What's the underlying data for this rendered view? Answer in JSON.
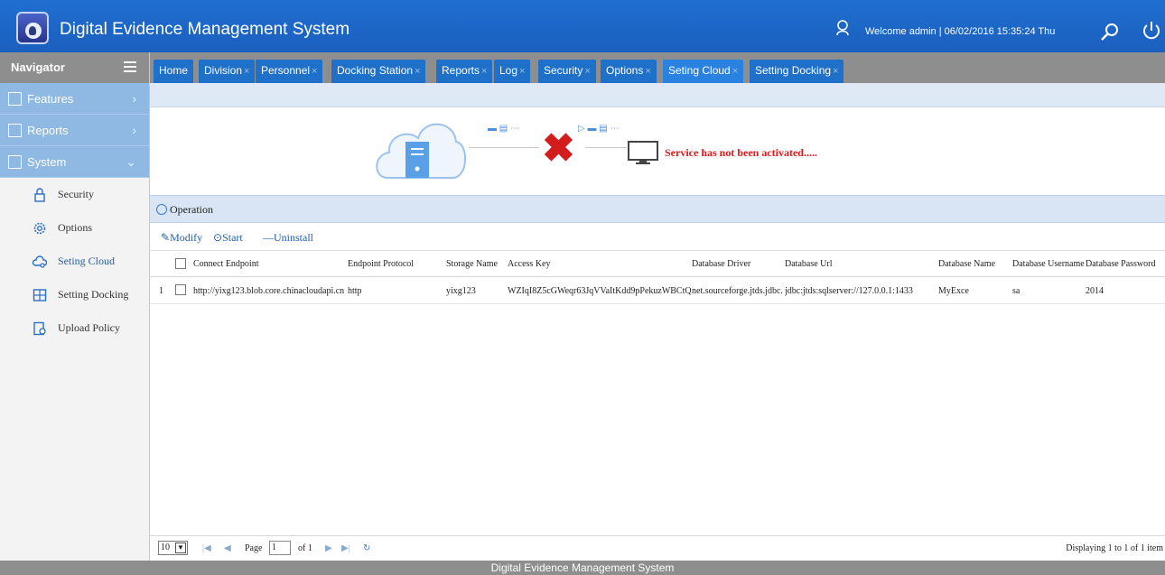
{
  "header": {
    "title": "Digital Evidence Management System",
    "welcome": "Welcome  admin |   06/02/2016 15:35:24 Thu"
  },
  "sidebar": {
    "title": "Navigator",
    "sections": [
      {
        "label": "Features"
      },
      {
        "label": "Reports"
      },
      {
        "label": "System"
      }
    ],
    "items": [
      {
        "label": "Security",
        "icon": "lock-icon"
      },
      {
        "label": "Options",
        "icon": "gear-icon"
      },
      {
        "label": "Seting Cloud",
        "icon": "cloud-settings-icon"
      },
      {
        "label": "Setting Docking",
        "icon": "docking-icon"
      },
      {
        "label": "Upload Policy",
        "icon": "upload-policy-icon"
      }
    ]
  },
  "tabs": [
    {
      "label": "Home"
    },
    {
      "label": "Division"
    },
    {
      "label": "Personnel"
    },
    {
      "label": "Docking Station"
    },
    {
      "label": "Reports"
    },
    {
      "label": "Log"
    },
    {
      "label": "Security"
    },
    {
      "label": "Options"
    },
    {
      "label": "Seting Cloud"
    },
    {
      "label": "Setting Docking"
    }
  ],
  "service": {
    "message": "Service has not been activated....."
  },
  "operation": {
    "title": "Operation",
    "modify": "Modify",
    "start": "Start",
    "uninstall": "Uninstall"
  },
  "table": {
    "headers": [
      "Connect Endpoint",
      "Endpoint Protocol",
      "Storage Name",
      "Access Key",
      "Database Driver",
      "Database Url",
      "Database Name",
      "Database Username",
      "Database Password"
    ],
    "rows": [
      {
        "index": "1",
        "connect_endpoint": "http://yixg123.blob.core.chinacloudapi.cn",
        "endpoint_protocol": "http",
        "storage_name": "yixg123",
        "access_key": "WZIqI8Z5cGWeqr63JqVVaItKdd9pPekuzWBCtQ",
        "database_driver": "net.sourceforge.jtds.jdbc.",
        "database_url": "jdbc:jtds:sqlserver://127.0.0.1:1433",
        "database_name": "MyExce",
        "database_username": "sa",
        "database_password": "2014"
      }
    ]
  },
  "pager": {
    "page_size": "10",
    "page_label": "Page",
    "page_value": "1",
    "of_label": "of 1",
    "display": "Displaying 1 to 1 of 1 item"
  },
  "footer": {
    "text": "Digital Evidence Management System"
  },
  "colors": {
    "header_blue": "#1f6fd0",
    "tab_blue": "#1f70c9",
    "section_blue": "#8fb9e2",
    "error_red": "#e01b1b"
  }
}
